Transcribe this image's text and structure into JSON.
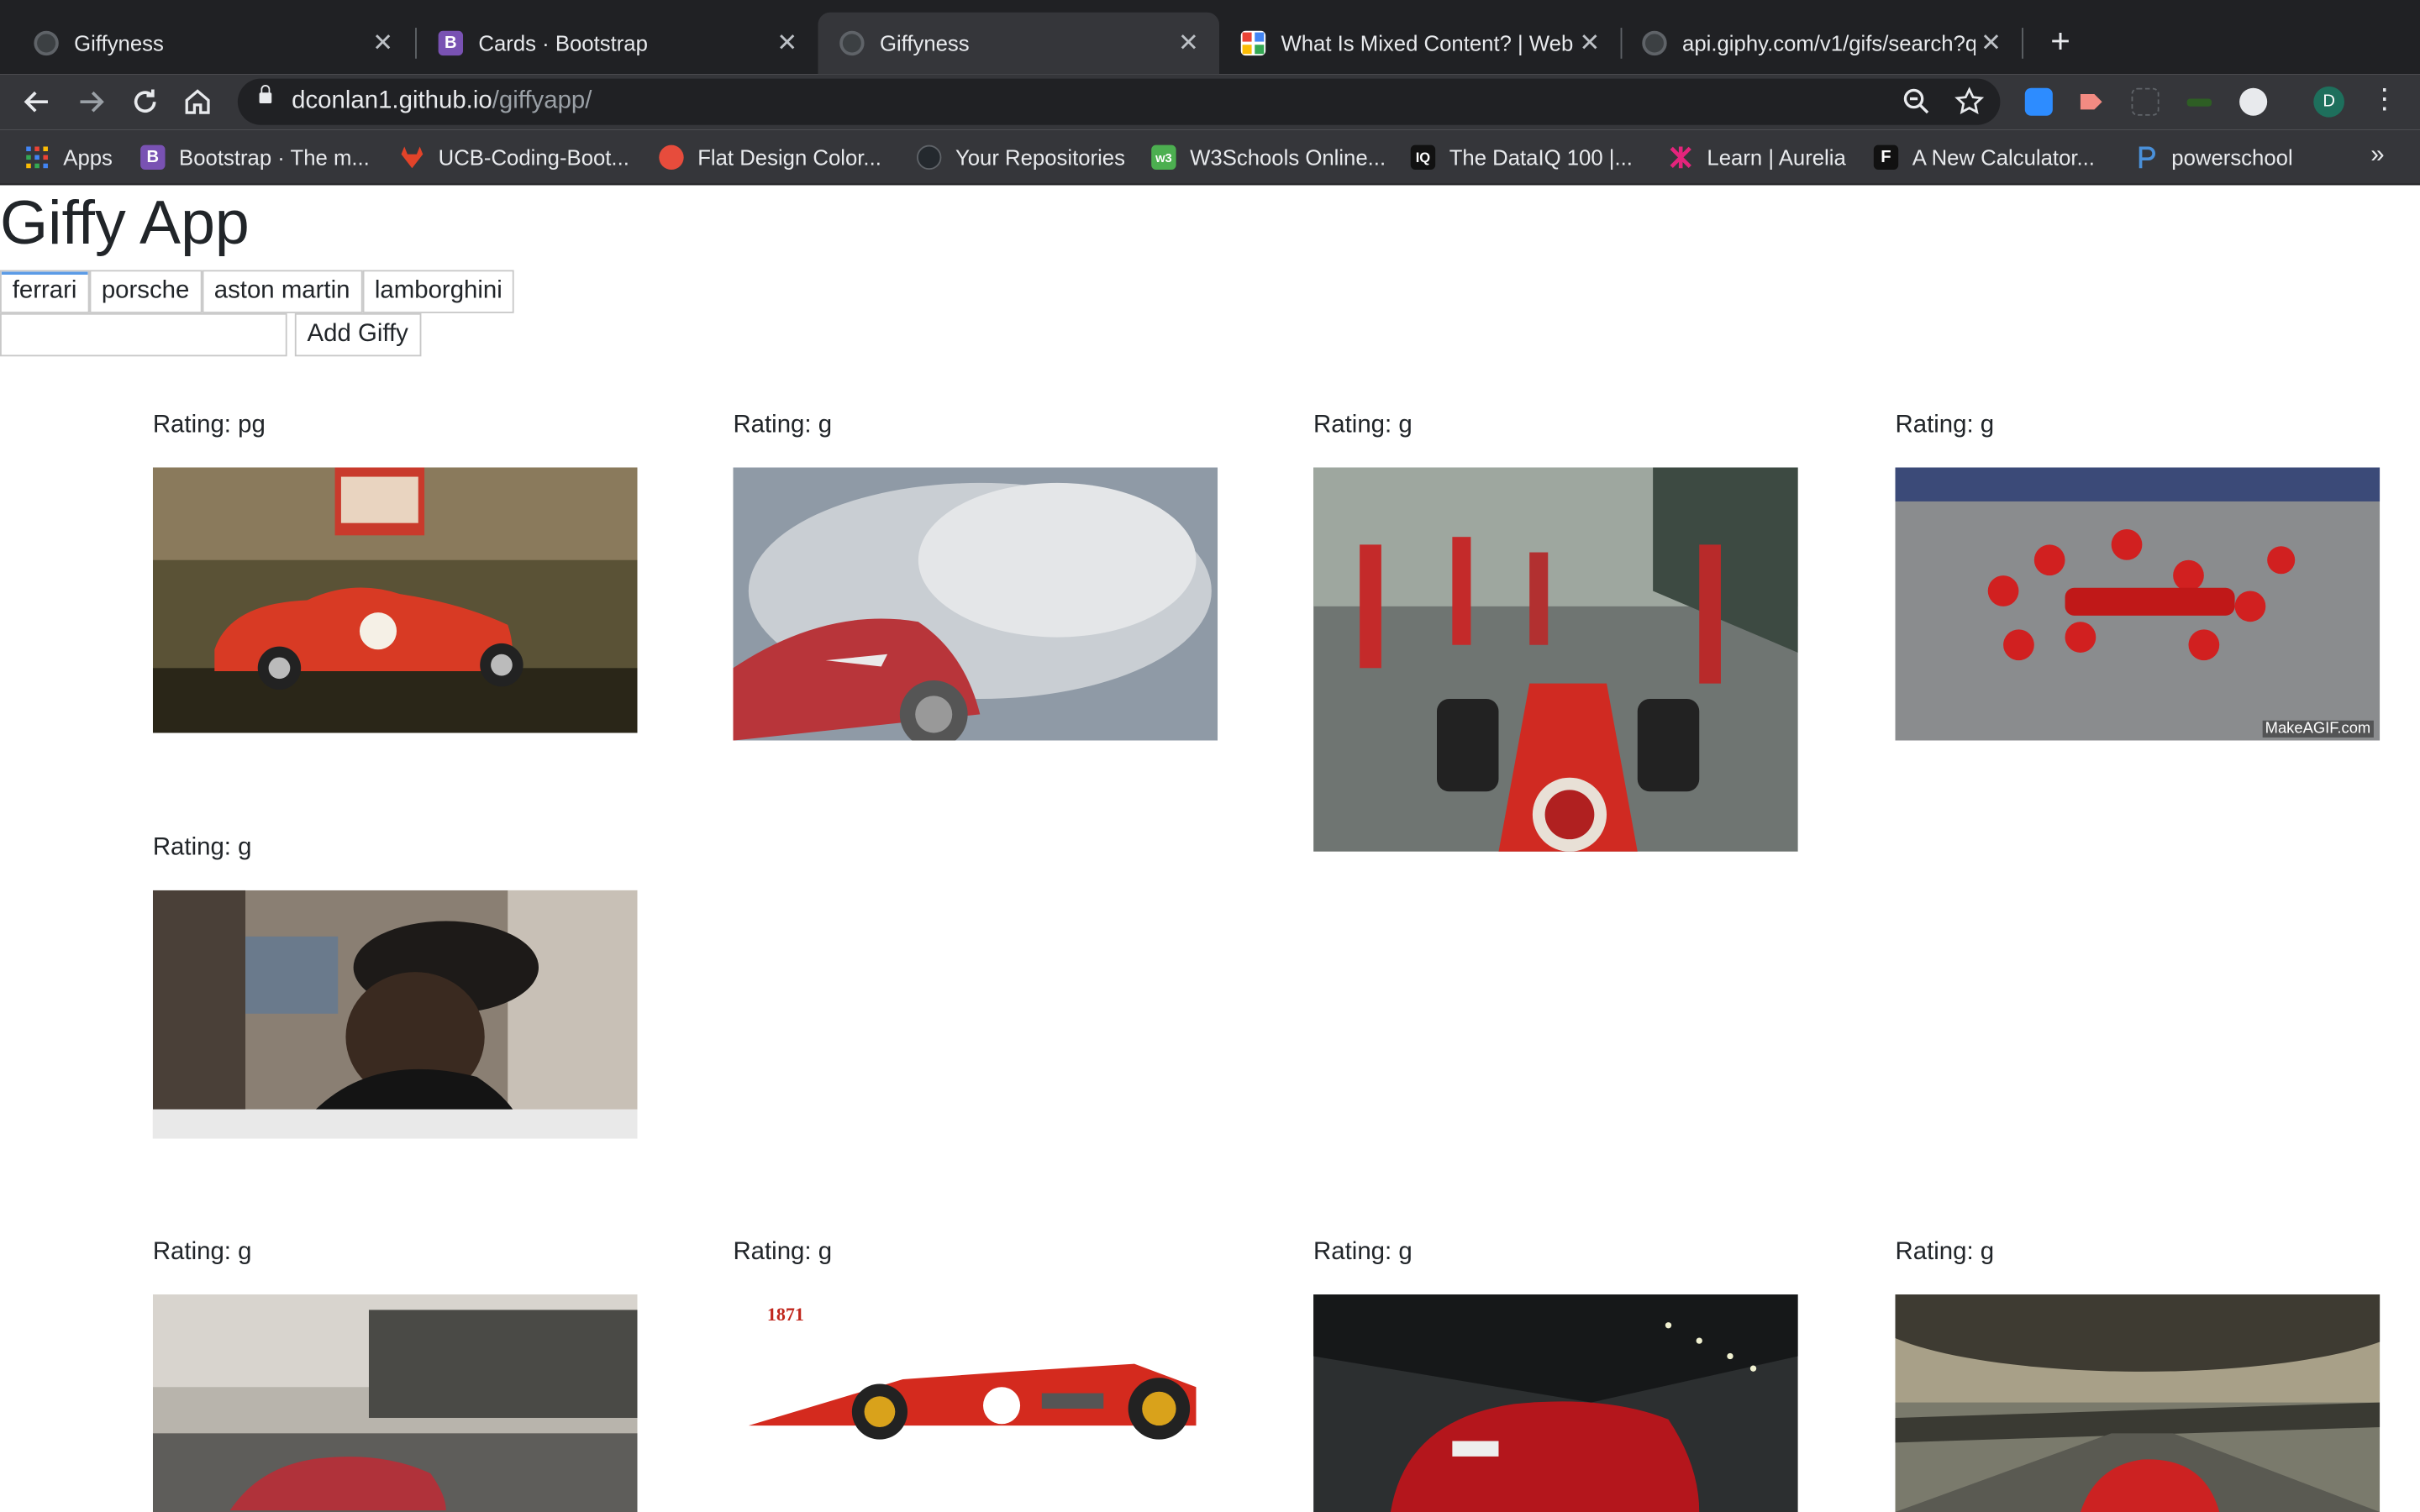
{
  "browser": {
    "tabs": [
      {
        "title": "Giffyness",
        "icon": "globe-icon",
        "active": false
      },
      {
        "title": "Cards · Bootstrap",
        "icon": "bootstrap-icon",
        "active": false
      },
      {
        "title": "Giffyness",
        "icon": "globe-icon",
        "active": true
      },
      {
        "title": "What Is Mixed Content?  |  Web",
        "icon": "mdn-icon",
        "active": false
      },
      {
        "title": "api.giphy.com/v1/gifs/search?q",
        "icon": "globe-icon",
        "active": false
      }
    ],
    "close_glyph": "✕",
    "new_tab_glyph": "+",
    "url_host": "dconlan1.github.io",
    "url_path": "/giffyapp/",
    "profile_initial": "D",
    "bookmarks": [
      {
        "label": "Apps",
        "icon": "apps-grid-icon",
        "color": "#4285f4"
      },
      {
        "label": "Bootstrap · The m...",
        "icon": "bootstrap-icon",
        "color": "#7952b3"
      },
      {
        "label": "UCB-Coding-Boot...",
        "icon": "gitlab-icon",
        "color": "#e24329"
      },
      {
        "label": "Flat Design Color...",
        "icon": "flatuicolors-icon",
        "color": "#e74c3c"
      },
      {
        "label": "Your Repositories",
        "icon": "github-icon",
        "color": "#24292e"
      },
      {
        "label": "W3Schools Online...",
        "icon": "w3schools-icon",
        "color": "#4caf50"
      },
      {
        "label": "The DataIQ 100 |...",
        "icon": "dataiq-icon",
        "color": "#111111"
      },
      {
        "label": "Learn | Aurelia",
        "icon": "aurelia-icon",
        "color": "#e4247c"
      },
      {
        "label": "A New Calculator...",
        "icon": "f-icon",
        "color": "#111111"
      },
      {
        "label": "powerschool",
        "icon": "powerschool-icon",
        "color": "#1b4f9c"
      }
    ],
    "bookmarks_overflow": "»"
  },
  "page": {
    "title": "Giffy App",
    "topics": [
      "ferrari",
      "porsche",
      "aston martin",
      "lamborghini"
    ],
    "new_topic_value": "",
    "add_button_label": "Add Giffy",
    "gifs": [
      {
        "rating": "Rating: pg",
        "subject": "red classic ferrari at mille miglia"
      },
      {
        "rating": "Rating: g",
        "subject": "red ferrari drifting in smoke"
      },
      {
        "rating": "Rating: g",
        "subject": "formula one cockpit view in pit lane"
      },
      {
        "rating": "Rating: g",
        "subject": "ferrari pit stop crew overhead",
        "watermark": "MakeAGIF.com"
      },
      {
        "rating": "Rating: g",
        "subject": "man in cap laughing"
      },
      {
        "rating": "Rating: g",
        "subject": "red ferrari daytona on road"
      },
      {
        "rating": "Rating: g",
        "subject": "1971 ferrari formula one illustration",
        "caption": "1871"
      },
      {
        "rating": "Rating: g",
        "subject": "red ferrari 458 in tunnel"
      },
      {
        "rating": "Rating: g",
        "subject": "red ferrari on highway at dusk"
      }
    ]
  }
}
